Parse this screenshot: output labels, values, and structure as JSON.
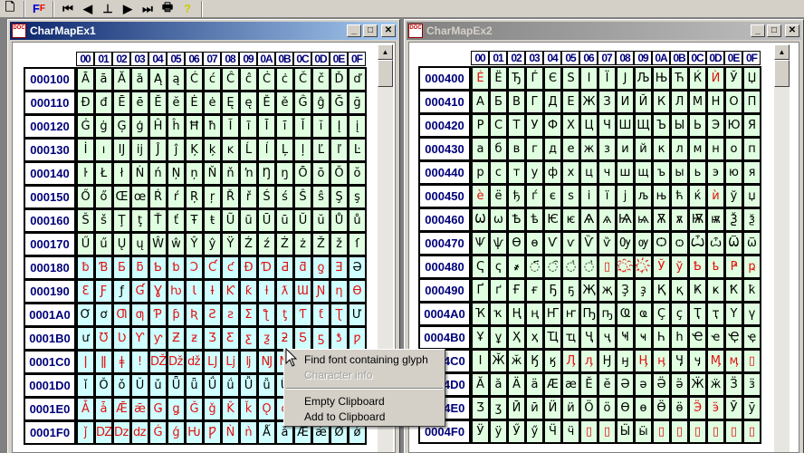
{
  "toolbar": {
    "buttons": [
      "new",
      "font",
      "first",
      "prev",
      "insert",
      "next",
      "last",
      "print",
      "help"
    ],
    "font_label": "FF"
  },
  "windows": [
    {
      "title": "CharMapEx1",
      "state": "active",
      "hex_headers": [
        "00",
        "01",
        "02",
        "03",
        "04",
        "05",
        "06",
        "07",
        "08",
        "09",
        "0A",
        "0B",
        "0C",
        "0D",
        "0E",
        "0F"
      ],
      "rows": [
        {
          "label": "000100",
          "chars": "ĀāĂăĄąĆćĈĉĊċČčĎď",
          "red": "0000000000000000",
          "bg": "g"
        },
        {
          "label": "000110",
          "chars": "ĐđĒēĔĕĖėĘęĚěĜĝĞğ",
          "red": "0000000000000000",
          "bg": "g"
        },
        {
          "label": "000120",
          "chars": "ĠġĢģĤĥĦħĨĩĪīĬĭĮį",
          "red": "0000000000000000",
          "bg": "g"
        },
        {
          "label": "000130",
          "chars": "İıĲĳĴĵĶķĸĹĺĻļĽľĿ",
          "red": "0000000000000000",
          "bg": "g"
        },
        {
          "label": "000140",
          "chars": "ŀŁłŃńŅņŇňŉŊŋŌōŎŏ",
          "red": "0000000000000000",
          "bg": "g"
        },
        {
          "label": "000150",
          "chars": "ŐőŒœŔŕŖŗŘřŚśŜŝŞş",
          "red": "0000000000000000",
          "bg": "g"
        },
        {
          "label": "000160",
          "chars": "ŠšŢţŤťŦŧŨũŪūŬŭŮů",
          "red": "0000000000000000",
          "bg": "g"
        },
        {
          "label": "000170",
          "chars": "ŰűŲųŴŵŶŷŸŹźŻżŽžſ",
          "red": "0000000000000000",
          "bg": "g"
        },
        {
          "label": "000180",
          "chars": "ƀƁƂƃƄƅƆƇƈƉƊƋƌƍƎƏ",
          "red": "1111111111111110",
          "bg": "b"
        },
        {
          "label": "000190",
          "chars": "ƐƑƒƓƔƕƖƗƘƙƚƛƜƝƞƟ",
          "red": "1101111111111111",
          "bg": "b"
        },
        {
          "label": "0001A0",
          "chars": "ƠơƢƣƤƥƦƧƨƩƪƫƬƭƮƯ",
          "red": "0011111111111110",
          "bg": "b"
        },
        {
          "label": "0001B0",
          "chars": "ưƱƲƳƴƵƶƷƸƹƺƻƼƽƾƿ",
          "red": "0111111111111111",
          "bg": "b"
        },
        {
          "label": "0001C0",
          "chars": "ǀǁǂǃǄǅǆǇǈǉǊǋǌǍǎǏ",
          "red": "1111111111111111",
          "bg": "b"
        },
        {
          "label": "0001D0",
          "chars": "ǐǑǒǓǔǕǖǗǘǙǚǛǜǝǞǟ",
          "red": "0000000000000000",
          "bg": "b"
        },
        {
          "label": "0001E0",
          "chars": "ǠǡǢǣǤǥǦǧǨǩǪǫǬǭǮǯ",
          "red": "1111111111111111",
          "bg": "b"
        },
        {
          "label": "0001F0",
          "chars": "ǰǱǲǳǴǵǶǷǸǹǺǻǼǽǾǿ",
          "red": "1111111111000000",
          "bg": "b"
        }
      ]
    },
    {
      "title": "CharMapEx2",
      "state": "inactive",
      "hex_headers": [
        "00",
        "01",
        "02",
        "03",
        "04",
        "05",
        "06",
        "07",
        "08",
        "09",
        "0A",
        "0B",
        "0C",
        "0D",
        "0E",
        "0F"
      ],
      "rows": [
        {
          "label": "000400",
          "chars": "ЀЁЂЃЄЅІЇЈЉЊЋЌЍЎЏ",
          "red": "1000000000000100",
          "bg": "g"
        },
        {
          "label": "000410",
          "chars": "АБВГДЕЖЗИЙКЛМНОП",
          "red": "0000000000000000",
          "bg": "g"
        },
        {
          "label": "000420",
          "chars": "РСТУФХЦЧШЩЪЫЬЭЮЯ",
          "red": "0000000000000000",
          "bg": "g"
        },
        {
          "label": "000430",
          "chars": "абвгдежзийклмноп",
          "red": "0000000000000000",
          "bg": "g"
        },
        {
          "label": "000440",
          "chars": "рстуфхцчшщъыьэюя",
          "red": "0000000000000000",
          "bg": "g"
        },
        {
          "label": "000450",
          "chars": "ѐёђѓєѕіїјљњћќѝўџ",
          "red": "1000000000000100",
          "bg": "g"
        },
        {
          "label": "000460",
          "chars": "ѠѡѢѣѤѥѦѧѨѩѪѫѬѭѮѯ",
          "red": "0000000000000000",
          "bg": "g"
        },
        {
          "label": "000470",
          "chars": "ѰѱѲѳѴѵѶѷѸѹѺѻѼѽѾѿ",
          "red": "0000000000000000",
          "bg": "g"
        },
        {
          "label": "000480",
          "chars": "Ҁҁ҂◌҃◌҄◌҅◌҆▯◌҈◌҉ЎўҌҍҎҏ",
          "red": "0000000111111111",
          "bg": "g"
        },
        {
          "label": "000490",
          "chars": "ҐґҒғҔҕҖҗҘҙҚқҜҝҞҟ",
          "red": "0000000000000000",
          "bg": "g"
        },
        {
          "label": "0004A0",
          "chars": "ҠҡҢңҤҥҦҧҨҩҪҫҬҭҮү",
          "red": "0000000000000000",
          "bg": "g"
        },
        {
          "label": "0004B0",
          "chars": "ҰұҲҳҴҵҶҷҸҹҺһҼҽҾҿ",
          "red": "0000000000000000",
          "bg": "g"
        },
        {
          "label": "0004C0",
          "chars": "ӀӁӂӃӄӅӆӇӈӉӊӋӌӍӎ▯",
          "red": "0000011001100111",
          "bg": "g"
        },
        {
          "label": "0004D0",
          "chars": "ӐӑӒӓӔӕӖӗӘәӚӛӜӝӞӟ",
          "red": "0000000000000000",
          "bg": "g"
        },
        {
          "label": "0004E0",
          "chars": "ӠӡӢӣӤӥӦӧӨөӪӫӬӭӮӯ",
          "red": "0000000000001100",
          "bg": "g"
        },
        {
          "label": "0004F0",
          "chars": "ӰӱӲӳӴӵ▯▯Ӹӹ▯▯▯▯▯▯",
          "red": "0000001100111111",
          "bg": "g"
        }
      ]
    }
  ],
  "context_menu": {
    "items": [
      {
        "label": "Find font containing glyph",
        "enabled": true
      },
      {
        "label": "Character info",
        "enabled": false
      },
      {
        "separator": true
      },
      {
        "label": "Empty Clipboard",
        "enabled": true
      },
      {
        "label": "Add to Clipboard",
        "enabled": true
      }
    ]
  },
  "colors": {
    "missing_glyph": "#e01010",
    "row_label": "#00007a",
    "cell_green": "#e0ffe0",
    "cell_cyan": "#d0ffff",
    "active_title": "#0a246a"
  }
}
